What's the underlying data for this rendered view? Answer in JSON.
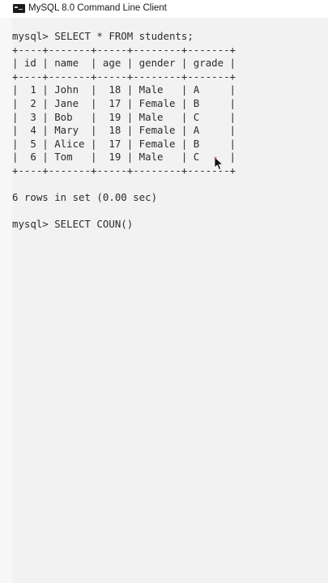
{
  "window": {
    "title": "MySQL 8.0 Command Line Client"
  },
  "console": {
    "prompt1": "mysql> SELECT * FROM students;",
    "border": "+----+-------+-----+--------+-------+",
    "header": "| id | name  | age | gender | grade |",
    "rows": [
      "|  1 | John  |  18 | Male   | A     |",
      "|  2 | Jane  |  17 | Female | B     |",
      "|  3 | Bob   |  19 | Male   | C     |",
      "|  4 | Mary  |  18 | Female | A     |",
      "|  5 | Alice |  17 | Female | B     |",
      "|  6 | Tom   |  19 | Male   | C     |"
    ],
    "result_summary": "6 rows in set (0.00 sec)",
    "prompt2": "mysql> SELECT COUN()"
  },
  "colors": {
    "console_bg": "#f2f2f2",
    "text": "#2b2b2b",
    "cursor_red": "#e0312b"
  },
  "icons": {
    "app": "terminal-icon",
    "pointer": "mouse-pointer-icon"
  }
}
